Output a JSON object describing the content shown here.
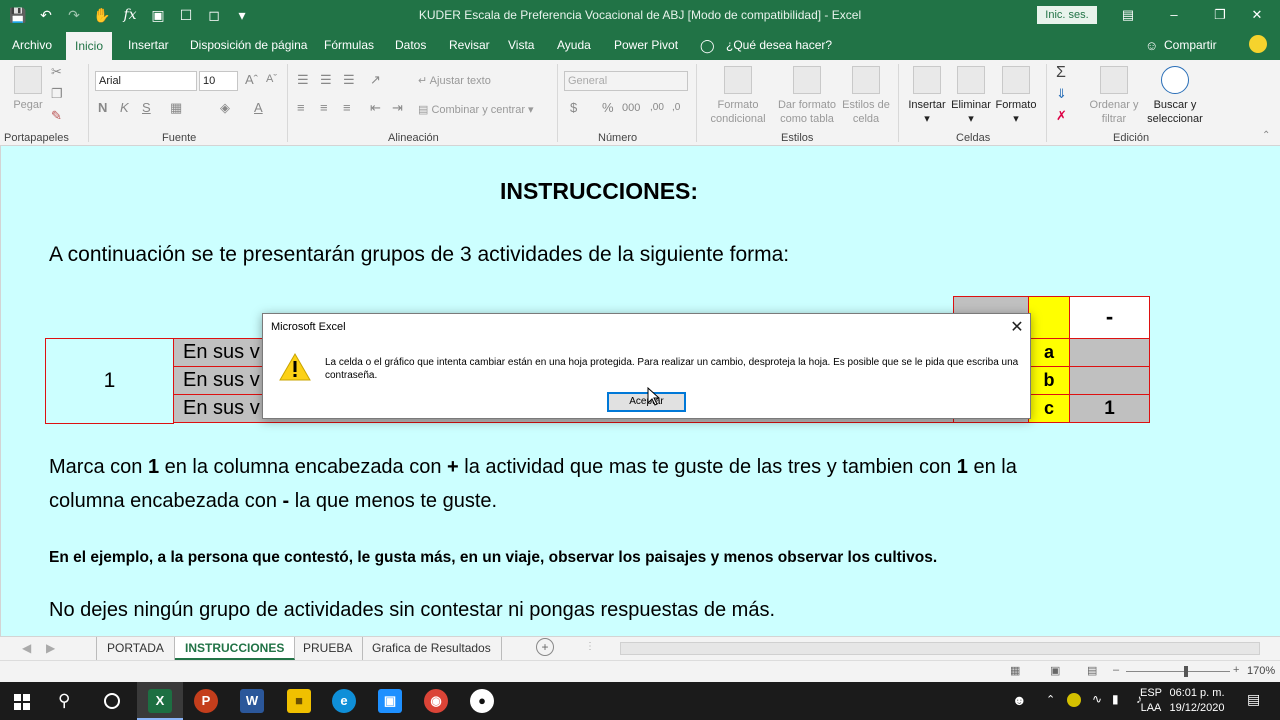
{
  "titlebar": {
    "title": "KUDER Escala de Preferencia Vocacional de ABJ  [Modo de compatibilidad]  -  Excel",
    "signin": "Inic. ses.",
    "qat": [
      "save-icon",
      "undo-icon",
      "redo-icon",
      "touch-icon",
      "function-icon",
      "form-icon",
      "print-preview-icon",
      "new-icon",
      "customize-icon"
    ]
  },
  "menu": {
    "tabs": [
      "Archivo",
      "Inicio",
      "Insertar",
      "Disposición de página",
      "Fórmulas",
      "Datos",
      "Revisar",
      "Vista",
      "Ayuda",
      "Power Pivot"
    ],
    "tell_me": "¿Qué desea hacer?",
    "share": "Compartir"
  },
  "ribbon": {
    "clipboard": {
      "paste": "Pegar",
      "label": "Portapapeles"
    },
    "font": {
      "name": "Arial",
      "size": "10",
      "label": "Fuente"
    },
    "alignment": {
      "wrap": "Ajustar texto",
      "merge": "Combinar y centrar",
      "label": "Alineación"
    },
    "number": {
      "format": "General",
      "label": "Número"
    },
    "styles": {
      "cond": "Formato condicional",
      "table": "Dar formato como tabla",
      "cell": "Estilos de celda",
      "label": "Estilos"
    },
    "cells": {
      "insert": "Insertar",
      "delete": "Eliminar",
      "format": "Formato",
      "label": "Celdas"
    },
    "editing": {
      "sort": "Ordenar y filtrar",
      "find": "Buscar y seleccionar",
      "label": "Edición"
    }
  },
  "sheet": {
    "heading": "INSTRUCCIONES:",
    "intro": "A continuación se te presentarán grupos de 3 actividades de la siguiente forma:",
    "example": {
      "number": "1",
      "activity_prefix": "En sus v",
      "header_minus": "-",
      "letters": [
        "a",
        "b",
        "c"
      ],
      "minus_answer": "1"
    },
    "para1_a": "Marca con ",
    "para1_b": "1",
    "para1_c": " en la columna encabezada con ",
    "para1_d": "+",
    "para1_e": " la actividad que mas te guste de las tres y tambien con ",
    "para1_f": "1",
    "para1_g": " en la",
    "para2_a": "columna encabezada con ",
    "para2_b": "-",
    "para2_c": " la que menos te guste.",
    "bold_note": "En el ejemplo, a la persona que contestó, le gusta más, en un viaje, observar los paisajes y menos observar los cultivos.",
    "line_last": "No dejes ningún grupo de actividades sin contestar ni pongas respuestas de más."
  },
  "dialog": {
    "title": "Microsoft Excel",
    "message": "La celda o el gráfico que intenta cambiar están en una hoja protegida. Para realizar un cambio, desproteja la hoja. Es posible que se le pida que escriba una contraseña.",
    "ok": "Aceptar"
  },
  "sheet_tabs": [
    "PORTADA",
    "INSTRUCCIONES",
    "PRUEBA",
    "Grafica de Resultados"
  ],
  "status": {
    "zoom": "170%"
  },
  "taskbar": {
    "lang1": "ESP",
    "lang2": "LAA",
    "time": "06:01 p. m.",
    "date": "19/12/2020"
  }
}
